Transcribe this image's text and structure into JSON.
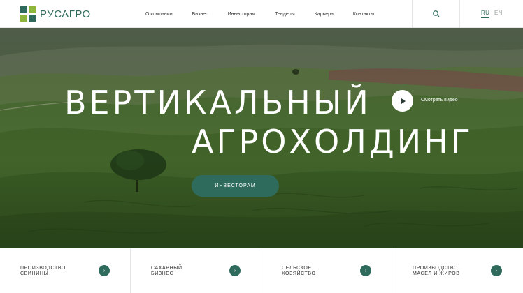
{
  "brand": {
    "name": "РУСАГРО",
    "logo_colors": [
      "#2f6b5c",
      "#8db63c",
      "#8db63c",
      "#2f6b5c"
    ]
  },
  "nav": {
    "items": [
      {
        "label": "О компании"
      },
      {
        "label": "Бизнес"
      },
      {
        "label": "Инвесторам"
      },
      {
        "label": "Тендеры"
      },
      {
        "label": "Карьера"
      },
      {
        "label": "Контакты"
      }
    ]
  },
  "header": {
    "search_icon": "search-icon",
    "lang_ru": "RU",
    "lang_en": "EN",
    "active_lang": "RU"
  },
  "hero": {
    "title_line1": "ВЕРТИКАЛЬНЫЙ",
    "title_line2": "АГРОХОЛДИНГ",
    "watch_video_label": "Смотреть видео",
    "play_icon": "play-icon",
    "cta_label": "ИНВЕСТОРАМ"
  },
  "cards": [
    {
      "line1": "Производство",
      "line2": "свинины"
    },
    {
      "line1": "Сахарный",
      "line2": "бизнес"
    },
    {
      "line1": "Сельское",
      "line2": "хозяйство"
    },
    {
      "line1": "Производство",
      "line2": "масел и жиров"
    }
  ],
  "colors": {
    "accent": "#2f6b5c",
    "accent_light": "#8db63c",
    "text": "#333333",
    "white": "#ffffff"
  }
}
